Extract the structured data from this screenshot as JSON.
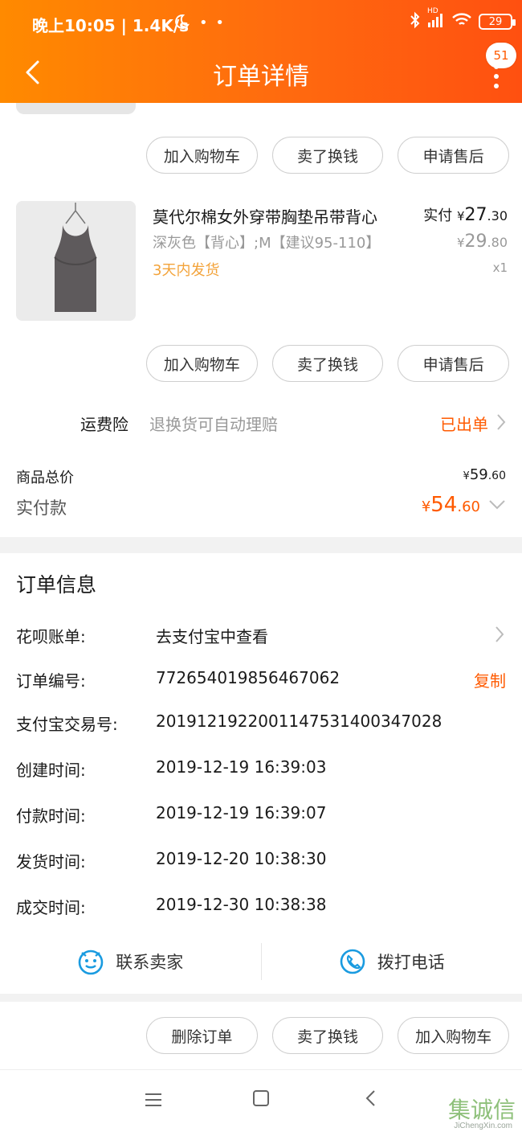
{
  "status_bar": {
    "time": "晚上10:05 | 1.4K/s",
    "extra": "• •",
    "battery": "29",
    "signal_label": "HD"
  },
  "nav": {
    "title": "订单详情",
    "badge": "51"
  },
  "buttons_top": [
    "加入购物车",
    "卖了换钱",
    "申请售后"
  ],
  "product": {
    "name": "莫代尔棉女外穿带胸垫吊带背心",
    "spec": "深灰色【背心】;M【建议95-110】",
    "shipping": "3天内发货",
    "paid_label": "实付",
    "paid_currency": "¥",
    "paid_int": "27",
    "paid_dec": ".30",
    "orig_currency": "¥",
    "orig_int": "29",
    "orig_dec": ".80",
    "qty": "x1"
  },
  "buttons_mid": [
    "加入购物车",
    "卖了换钱",
    "申请售后"
  ],
  "insurance": {
    "label": "运费险",
    "desc": "退换货可自动理赔",
    "status": "已出单"
  },
  "totals": {
    "goods_label": "商品总价",
    "goods_currency": "¥",
    "goods_int": "59",
    "goods_dec": ".60",
    "paid_label": "实付款",
    "paid_currency": "¥",
    "paid_int": "54",
    "paid_dec": ".60"
  },
  "order_info": {
    "title": "订单信息",
    "rows": [
      {
        "key": "花呗账单:",
        "value": "去支付宝中查看"
      },
      {
        "key": "订单编号:",
        "value": "772654019856467062",
        "action": "复制"
      },
      {
        "key": "支付宝交易号:",
        "value": "2019121922001147531400347028"
      },
      {
        "key": "创建时间:",
        "value": "2019-12-19 16:39:03"
      },
      {
        "key": "付款时间:",
        "value": "2019-12-19 16:39:07"
      },
      {
        "key": "发货时间:",
        "value": "2019-12-20 10:38:30"
      },
      {
        "key": "成交时间:",
        "value": "2019-12-30 10:38:38"
      }
    ]
  },
  "contact": {
    "seller": "联系卖家",
    "phone": "拨打电话"
  },
  "buttons_bottom": [
    "删除订单",
    "卖了换钱",
    "加入购物车"
  ],
  "watermark": {
    "glyphs": "集诚信",
    "url": "JiChengXin.com"
  },
  "colors": {
    "accent": "#ff5a00",
    "header_start": "#ff8a00",
    "header_end": "#ff5010",
    "ship_note": "#f3a33a"
  }
}
